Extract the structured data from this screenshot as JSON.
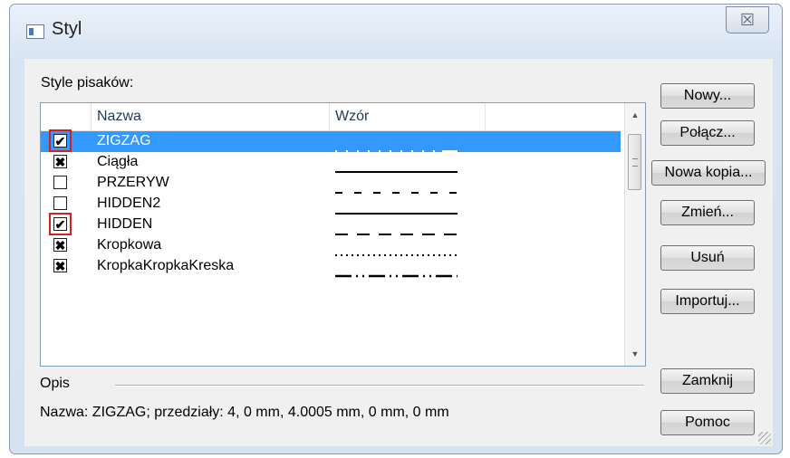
{
  "window": {
    "title": "Styl",
    "close_symbol": "☒"
  },
  "list_label": "Style pisaków:",
  "columns": [
    "Nazwa",
    "Wzór"
  ],
  "rows": [
    {
      "name": "ZIGZAG",
      "check": "✔",
      "selected": true,
      "highlight": true,
      "pattern": "zigzag"
    },
    {
      "name": "Ciągła",
      "check": "✖",
      "selected": false,
      "highlight": false,
      "pattern": "solid"
    },
    {
      "name": "PRZERYW",
      "check": "",
      "selected": false,
      "highlight": false,
      "pattern": "dashed"
    },
    {
      "name": "HIDDEN2",
      "check": "",
      "selected": false,
      "highlight": false,
      "pattern": "solid"
    },
    {
      "name": "HIDDEN",
      "check": "✔",
      "selected": false,
      "highlight": true,
      "pattern": "longdash"
    },
    {
      "name": "Kropkowa",
      "check": "✖",
      "selected": false,
      "highlight": false,
      "pattern": "dotted"
    },
    {
      "name": "KropkaKropkaKreska",
      "check": "✖",
      "selected": false,
      "highlight": false,
      "pattern": "dashdotdot"
    }
  ],
  "buttons": {
    "new": "Nowy...",
    "merge": "Połącz...",
    "copy": "Nowa kopia...",
    "edit": "Zmień...",
    "delete": "Usuń",
    "import": "Importuj...",
    "close": "Zamknij",
    "help": "Pomoc"
  },
  "description_label": "Opis",
  "description_text": "Nazwa: ZIGZAG; przedziały: 4, 0 mm, 4.0005 mm, 0 mm, 0 mm",
  "colors": {
    "selection": "#3399ff",
    "highlight_box": "#d42020"
  }
}
